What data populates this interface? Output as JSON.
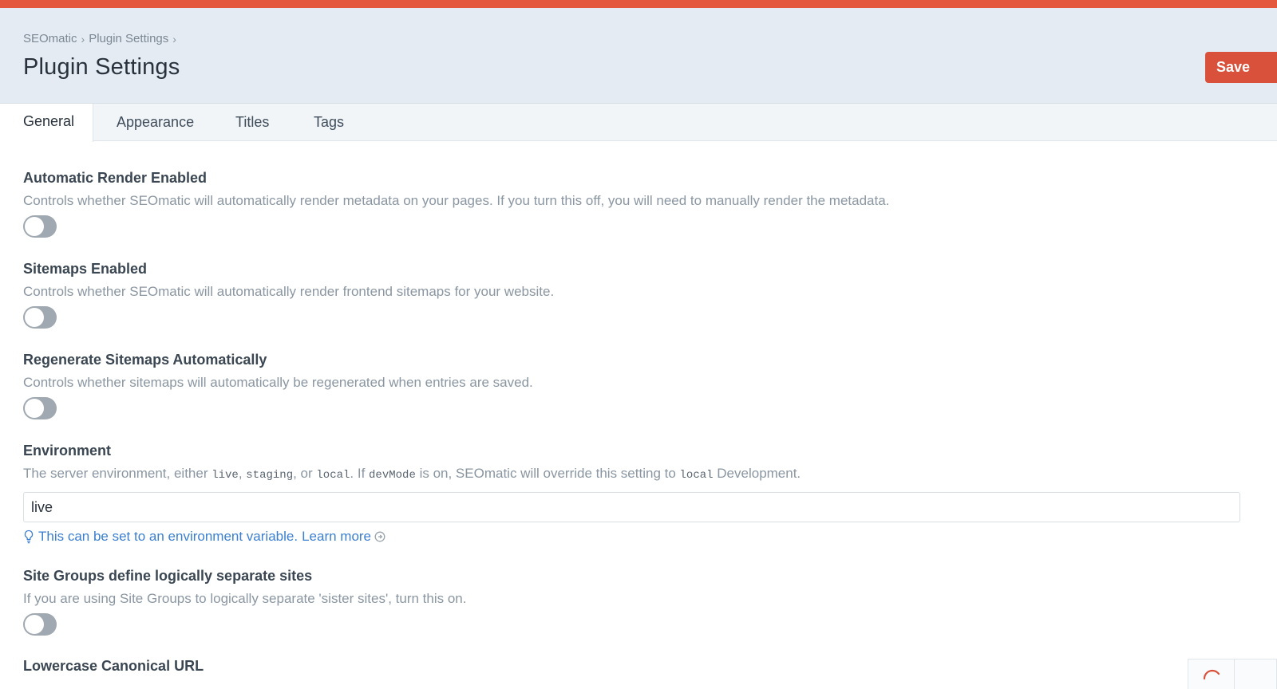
{
  "header": {
    "breadcrumb": [
      "SEOmatic",
      "Plugin Settings"
    ],
    "breadcrumb_separator": "›",
    "title": "Plugin Settings",
    "save_label": "Save"
  },
  "tabs": [
    {
      "label": "General",
      "active": true
    },
    {
      "label": "Appearance",
      "active": false
    },
    {
      "label": "Titles",
      "active": false
    },
    {
      "label": "Tags",
      "active": false
    }
  ],
  "fields": {
    "render": {
      "label": "Automatic Render Enabled",
      "desc": "Controls whether SEOmatic will automatically render metadata on your pages. If you turn this off, you will need to manually render the metadata.",
      "enabled": false
    },
    "sitemaps": {
      "label": "Sitemaps Enabled",
      "desc": "Controls whether SEOmatic will automatically render frontend sitemaps for your website.",
      "enabled": false
    },
    "regenerate": {
      "label": "Regenerate Sitemaps Automatically",
      "desc": "Controls whether sitemaps will automatically be regenerated when entries are saved.",
      "enabled": false
    },
    "environment": {
      "label": "Environment",
      "desc_parts": [
        "The server environment, either ",
        "live",
        ", ",
        "staging",
        ", or ",
        "local",
        ". If ",
        "devMode",
        " is on, SEOmatic will override this setting to ",
        "local",
        " Development."
      ],
      "value": "live",
      "hint": "This can be set to an environment variable.",
      "learn_more": "Learn more"
    },
    "site_groups": {
      "label": "Site Groups define logically separate sites",
      "desc": "If you are using Site Groups to logically separate 'sister sites', turn this on.",
      "enabled": false
    },
    "lowercase": {
      "label": "Lowercase Canonical URL"
    }
  },
  "colors": {
    "accent": "#e5573d",
    "save_button": "#d9513b",
    "link": "#3a7fd0",
    "toggle_off": "#a0a8b1"
  },
  "icons": [
    "lightbulb-icon",
    "arrow-circle-icon",
    "spinner-icon"
  ]
}
